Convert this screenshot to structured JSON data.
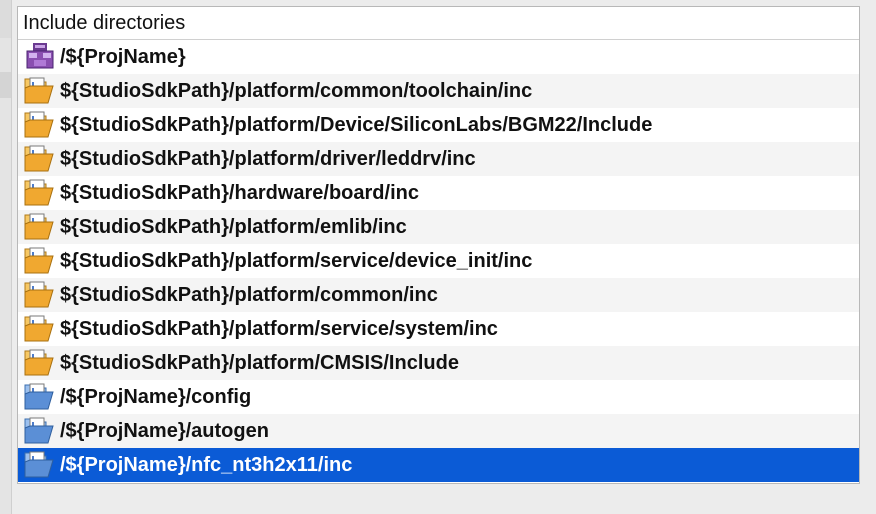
{
  "header": {
    "title": "Include directories"
  },
  "rows": [
    {
      "label": "/${ProjName}",
      "icon": "project-folder-icon"
    },
    {
      "label": "${StudioSdkPath}/platform/common/toolchain/inc",
      "icon": "include-folder-icon"
    },
    {
      "label": "${StudioSdkPath}/platform/Device/SiliconLabs/BGM22/Include",
      "icon": "include-folder-icon"
    },
    {
      "label": "${StudioSdkPath}/platform/driver/leddrv/inc",
      "icon": "include-folder-icon"
    },
    {
      "label": "${StudioSdkPath}/hardware/board/inc",
      "icon": "include-folder-icon"
    },
    {
      "label": "${StudioSdkPath}/platform/emlib/inc",
      "icon": "include-folder-icon"
    },
    {
      "label": "${StudioSdkPath}/platform/service/device_init/inc",
      "icon": "include-folder-icon"
    },
    {
      "label": "${StudioSdkPath}/platform/common/inc",
      "icon": "include-folder-icon"
    },
    {
      "label": "${StudioSdkPath}/platform/service/system/inc",
      "icon": "include-folder-icon"
    },
    {
      "label": "${StudioSdkPath}/platform/CMSIS/Include",
      "icon": "include-folder-icon"
    },
    {
      "label": "/${ProjName}/config",
      "icon": "workspace-include-folder-icon"
    },
    {
      "label": "/${ProjName}/autogen",
      "icon": "workspace-include-folder-icon"
    },
    {
      "label": "/${ProjName}/nfc_nt3h2x11/inc",
      "icon": "workspace-include-folder-icon",
      "selected": true
    }
  ],
  "colors": {
    "selection": "#0b5bd6",
    "folder_orange": "#f0a830",
    "folder_blue": "#5b8fd6",
    "project_purple": "#8a4fb0"
  }
}
